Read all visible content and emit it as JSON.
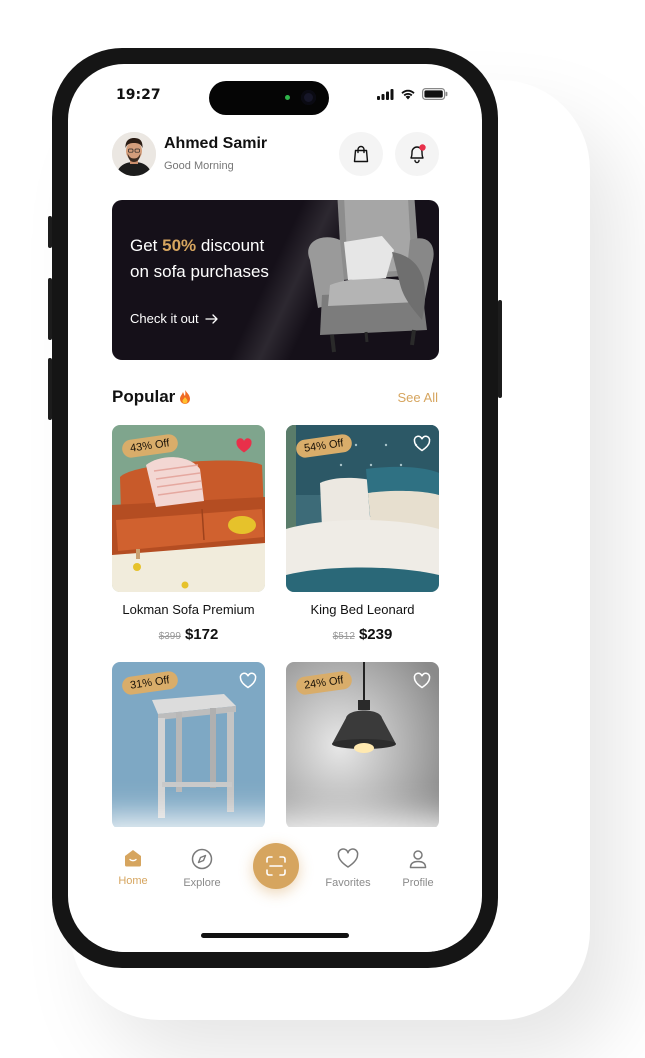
{
  "status_bar": {
    "time": "19:27"
  },
  "user": {
    "name": "Ahmed Samir",
    "greeting": "Good Morning"
  },
  "banner": {
    "line1_prefix": "Get ",
    "discount": "50%",
    "line1_suffix": " discount",
    "line2": "on sofa purchases",
    "cta": "Check it out"
  },
  "section": {
    "title": "Popular",
    "see_all": "See All"
  },
  "products": [
    {
      "name": "Lokman Sofa Premium",
      "old_price": "$399",
      "price": "$172",
      "badge": "43% Off",
      "favorited": true
    },
    {
      "name": "King Bed Leonard",
      "old_price": "$512",
      "price": "$239",
      "badge": "54% Off",
      "favorited": false
    },
    {
      "name": "",
      "old_price": "",
      "price": "",
      "badge": "31% Off",
      "favorited": false
    },
    {
      "name": "",
      "old_price": "",
      "price": "",
      "badge": "24% Off",
      "favorited": false
    }
  ],
  "tabs": [
    {
      "label": "Home",
      "icon": "home-icon",
      "active": true
    },
    {
      "label": "Explore",
      "icon": "compass-icon",
      "active": false
    },
    {
      "label": "",
      "icon": "scan-icon",
      "active": false
    },
    {
      "label": "Favorites",
      "icon": "heart-icon",
      "active": false
    },
    {
      "label": "Profile",
      "icon": "user-icon",
      "active": false
    }
  ],
  "colors": {
    "accent": "#d6a55f",
    "banner_bg": "#151019",
    "favorite": "#e8304a"
  }
}
